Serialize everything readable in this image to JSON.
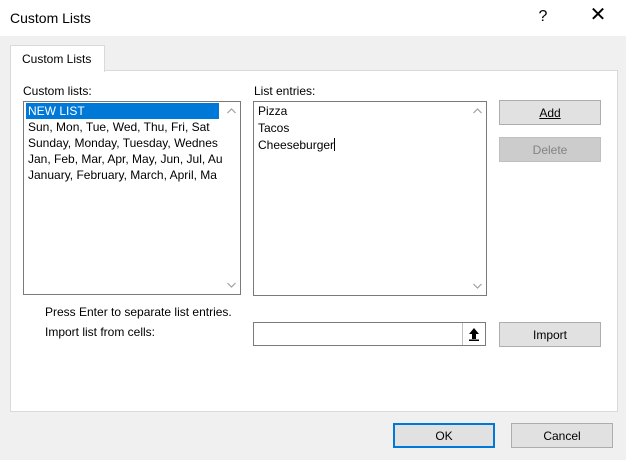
{
  "window": {
    "title": "Custom Lists",
    "help_glyph": "?",
    "close_glyph": "✕"
  },
  "tabs": [
    {
      "label": "Custom Lists"
    }
  ],
  "custom_lists": {
    "label": "Custom lists:",
    "items": [
      "NEW LIST",
      "Sun, Mon, Tue, Wed, Thu, Fri, Sat",
      "Sunday, Monday, Tuesday, Wednes",
      "Jan, Feb, Mar, Apr, May, Jun, Jul, Au",
      "January, February, March, April, Ma"
    ],
    "selected_index": 0
  },
  "list_entries": {
    "label": "List entries:",
    "lines": [
      "Pizza",
      "Tacos",
      "Cheeseburger"
    ]
  },
  "buttons": {
    "add": "Add",
    "delete": "Delete",
    "import": "Import",
    "ok": "OK",
    "cancel": "Cancel"
  },
  "hint": "Press Enter to separate list entries.",
  "import_label": "Import list from cells:",
  "import_input": {
    "value": ""
  },
  "icons": {
    "picker": "upload-arrow-icon"
  },
  "colors": {
    "selection": "#0078d7",
    "ok_border": "#0078d7"
  }
}
